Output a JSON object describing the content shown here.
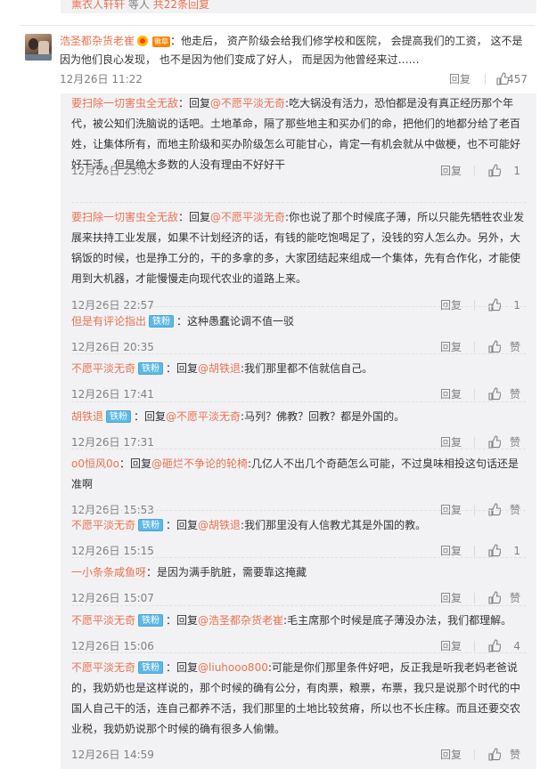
{
  "top": {
    "user": "熏衣人轩轩",
    "suffix": "等人",
    "total": "共22条回复"
  },
  "main_comment": {
    "author": "浩圣都杂货老崔",
    "badge": "徽章",
    "text": "：他走后， 资产阶级会给我们修学校和医院， 会提高我们的工资， 这不是因为他们良心发现， 也不是因为他们变成了好人， 而是因为他曾经来过……",
    "time": "12月26日 11:22",
    "reply_label": "回复",
    "likes": "457"
  },
  "replies": [
    {
      "author": "要扫除一切害虫全无敌",
      "fan": "",
      "reply_word": "：回复",
      "at": "@不愿平淡无奇",
      "text": ":吃大锅没有活力，恐怕都是没有真正经历那个年代，被公知们洗脑说的话吧。土地革命，隔了那些地主和买办们的命，把他们的地都分给了老百姓，让集体所有，而地主阶级和买办阶级怎么可能甘心，肯定一有机会就从中做梗，也不可能好好干活，但是绝大多数的人没有理由不好好干",
      "time": "12月26日 23:02",
      "reply_label": "回复",
      "likes": "1"
    },
    {
      "author": "要扫除一切害虫全无敌",
      "fan": "",
      "reply_word": "：回复",
      "at": "@不愿平淡无奇",
      "text": ":你也说了那个时候底子薄，所以只能先牺牲农业发展来扶持工业发展，如果不计划经济的话，有钱的能吃饱喝足了，没钱的穷人怎么办。另外，大锅饭的时候，也是挣工分的，干的多拿的多，大家团结起来组成一个集体，先有合作化，才能使用到大机器，才能慢慢走向现代农业的道路上来。",
      "time": "12月26日 22:57",
      "reply_label": "回复",
      "likes": "1"
    },
    {
      "author": "但是有评论指出",
      "fan": "铁粉",
      "reply_word": "",
      "at": "",
      "text": "：这种愚蠢论调不值一驳",
      "time": "12月26日 20:35",
      "reply_label": "回复",
      "likes": "赞"
    },
    {
      "author": "不愿平淡无奇",
      "fan": "铁粉",
      "reply_word": "：回复",
      "at": "@胡铁退",
      "text": ":我们那里都不信就信自己。",
      "time": "12月26日 17:41",
      "reply_label": "回复",
      "likes": "赞"
    },
    {
      "author": "胡铁退",
      "fan": "铁粉",
      "reply_word": "：回复",
      "at": "@不愿平淡无奇",
      "text": ":马列？佛教？回教？都是外国的。",
      "time": "12月26日 17:31",
      "reply_label": "回复",
      "likes": "赞"
    },
    {
      "author": "o0恒风0o",
      "fan": "",
      "reply_word": "：回复",
      "at": "@砸烂不争论的轮椅",
      "text": ":几亿人不出几个奇葩怎么可能，不过臭味相投这句话还是准啊",
      "time": "12月26日 15:53",
      "reply_label": "回复",
      "likes": "赞"
    },
    {
      "author": "不愿平淡无奇",
      "fan": "铁粉",
      "reply_word": "：回复",
      "at": "@胡铁退",
      "text": ":我们那里没有人信教尤其是外国的教。",
      "time": "12月26日 15:15",
      "reply_label": "回复",
      "likes": "1"
    },
    {
      "author": "一小条条咸鱼呀",
      "fan": "",
      "reply_word": "",
      "at": "",
      "text": "：是因为满手肮脏，需要靠这掩藏",
      "time": "12月26日 15:07",
      "reply_label": "回复",
      "likes": "赞"
    },
    {
      "author": "不愿平淡无奇",
      "fan": "铁粉",
      "reply_word": "：回复",
      "at": "@浩圣都杂货老崔",
      "text": ":毛主席那个时候是底子薄没办法，我们都理解。",
      "time": "12月26日 15:06",
      "reply_label": "回复",
      "likes": "4"
    },
    {
      "author": "不愿平淡无奇",
      "fan": "铁粉",
      "reply_word": "：回复",
      "at": "@liuhooo800",
      "text": ":可能是你们那里条件好吧，反正我是听我老妈老爸说的，我奶奶也是这样说的，那个时候的确有公分，有肉票，粮票，布票，我只是说那个时代的中国人自己干的活，连自己都养不活，我们那里的土地比较贫瘠，所以也不长庄稼。而且还要交农业税，我奶奶说那个时候的确有很多人偷懒。",
      "time": "12月26日 14:59",
      "reply_label": "回复",
      "likes": "赞"
    }
  ],
  "colors": {
    "accent": "#eb7350",
    "text": "#333333",
    "muted": "#808080",
    "thread_bg": "#f2f2f5",
    "fan_badge": "#5cb8e5"
  },
  "icons": {
    "like": "thumbs-up-icon",
    "vip": "vip-crown-icon",
    "fan": "fan-badge-icon"
  }
}
